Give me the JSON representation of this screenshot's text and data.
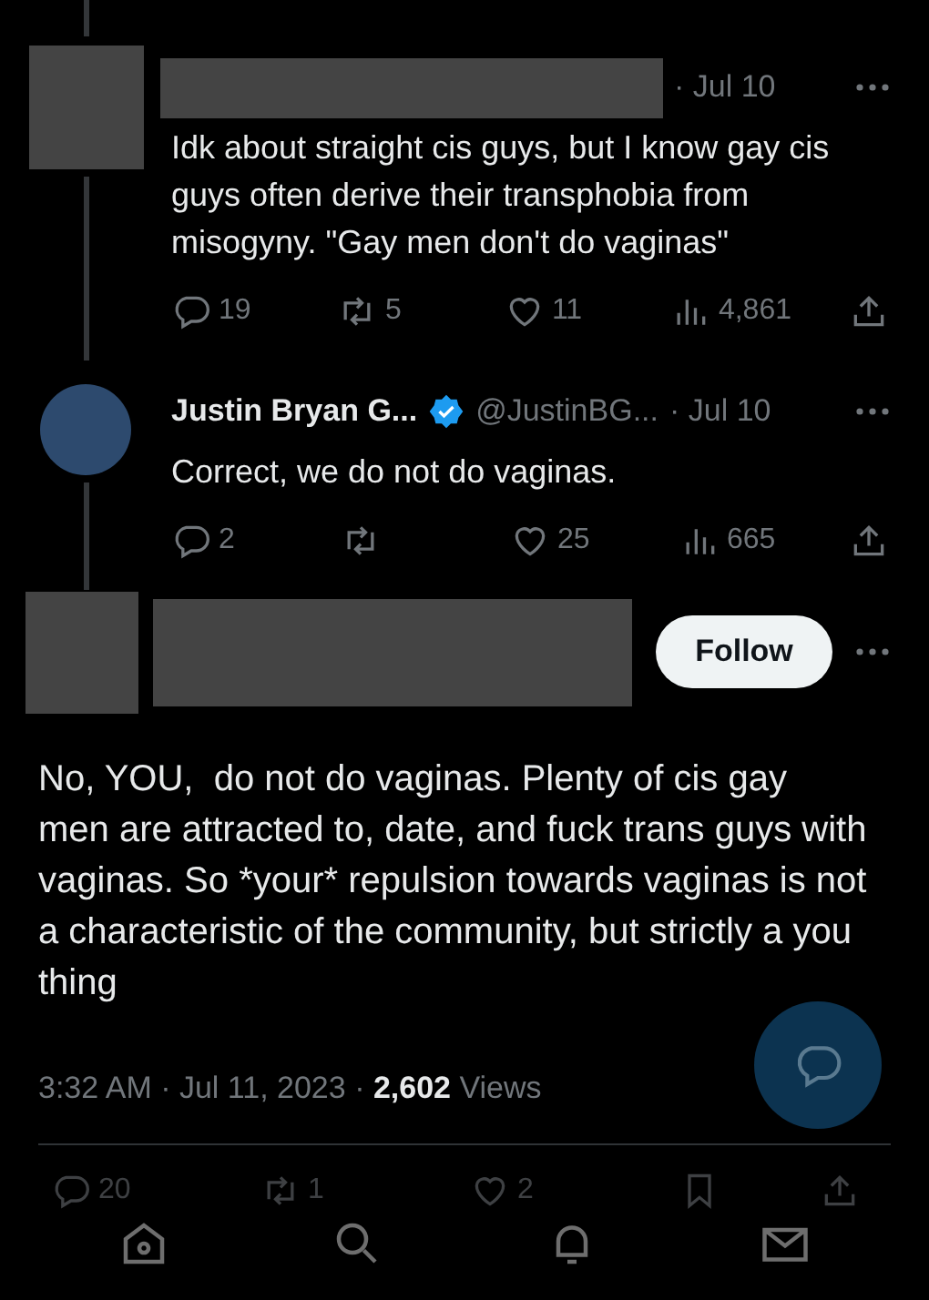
{
  "thread": [
    {
      "kind": "redacted",
      "date": "· Jul 10",
      "text": "Idk about straight cis guys, but I know gay cis guys often derive their transphobia from misogyny. \"Gay men don't do vaginas\"",
      "replies": "19",
      "reposts": "5",
      "likes": "11",
      "views": "4,861"
    },
    {
      "kind": "profile",
      "name": "Justin Bryan G...",
      "verified": true,
      "handle": "@JustinBG...",
      "date": "· Jul 10",
      "text": "Correct, we do not do vaginas.",
      "replies": "2",
      "likes": "25",
      "views": "665"
    }
  ],
  "main_tweet": {
    "follow_button": "Follow",
    "text": "No, YOU,  do not do vaginas. Plenty of cis gay men are attracted to, date, and fuck trans guys with vaginas. So *your* repulsion towards vaginas is not a characteristic of the community, but strictly a you thing",
    "meta": "3:32 AM · Jul 11, 2023 · **2,602** Views",
    "replies": "20",
    "reposts": "1",
    "likes": "2"
  }
}
